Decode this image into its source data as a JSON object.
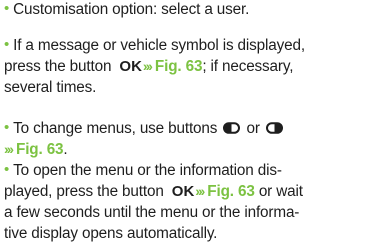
{
  "paragraphs": {
    "p1": {
      "text": "Customisation option: select a user."
    },
    "p2": {
      "line1": "If a message or vehicle symbol is displayed,",
      "line2a": "press the button",
      "ok": "OK",
      "arrows": "›››",
      "fig": "Fig. 63",
      "line2b": "; if necessary,",
      "line3": "several times."
    },
    "p3": {
      "text_a": "To change menus, use buttons",
      "or": "or",
      "arrows": "›››",
      "fig": "Fig. 63",
      "end": "."
    },
    "p4": {
      "line1": "To open the menu or the information dis-",
      "line2a": "played, press the button",
      "ok": "OK",
      "arrows": "›››",
      "fig": "Fig. 63",
      "line2b": "or wait",
      "line3": "a few seconds until the menu or the informa-",
      "line4": "tive display opens automatically."
    }
  },
  "colors": {
    "accent": "#7cc242",
    "text": "#1e1e1e"
  },
  "icons": {
    "bullet": "•",
    "left_button": "rounded-left-button-icon",
    "right_button": "rounded-right-button-icon"
  }
}
